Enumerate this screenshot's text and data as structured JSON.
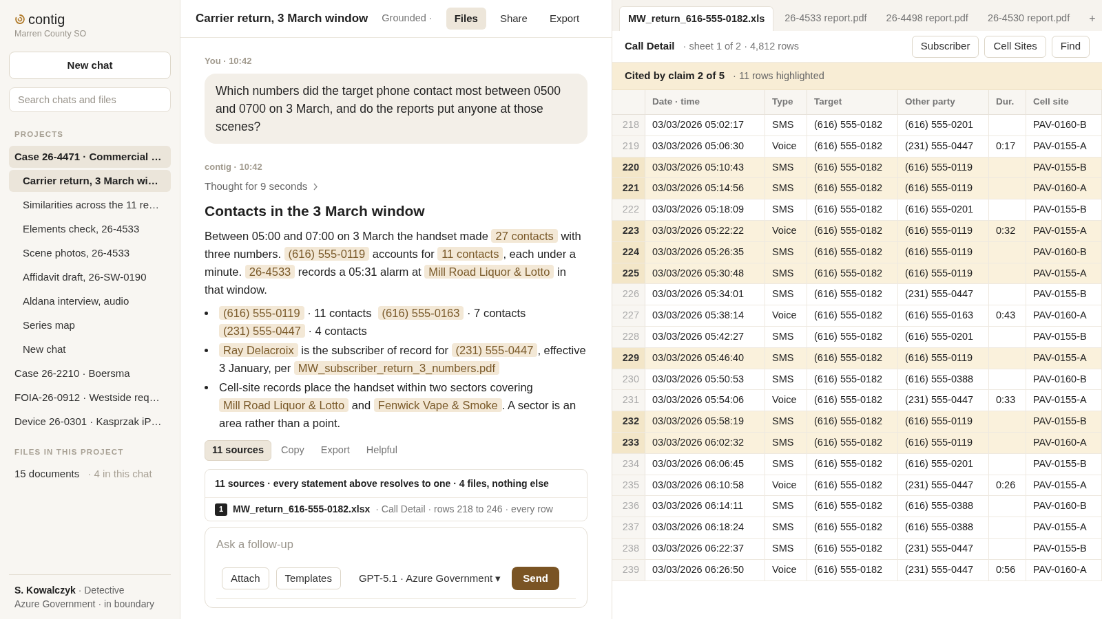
{
  "sidebar": {
    "brand": "contig",
    "org": "Marren County SO",
    "new_chat": "New chat",
    "search": {
      "placeholder": "Search chats and files"
    },
    "projects_heading": "PROJECTS",
    "projects": [
      {
        "label": "Case 26-4471 · Commercial …",
        "selected": true,
        "children": [
          {
            "label": "Carrier return, 3 March wi…",
            "selected": true
          },
          {
            "label": "Similarities across the 11 re…",
            "selected": false
          },
          {
            "label": "Elements check, 26-4533",
            "selected": false
          },
          {
            "label": "Scene photos, 26-4533",
            "selected": false
          },
          {
            "label": "Affidavit draft, 26-SW-0190",
            "selected": false
          },
          {
            "label": "Aldana interview, audio",
            "selected": false
          },
          {
            "label": "Series map",
            "selected": false
          },
          {
            "label": "New chat",
            "selected": false
          }
        ]
      },
      {
        "label": "Case 26-2210 · Boersma",
        "selected": false
      },
      {
        "label": "FOIA-26-0912 · Westside req…",
        "selected": false
      },
      {
        "label": "Device 26-0301 · Kasprzak iP…",
        "selected": false
      }
    ],
    "files_heading": "FILES IN THIS PROJECT",
    "files_count": "15 documents",
    "files_note": "· 4 in this chat",
    "user": {
      "name": "S. Kowalczyk",
      "role": "· Detective",
      "env": "Azure Government · in boundary"
    }
  },
  "chat": {
    "title": "Carrier return, 3 March window",
    "grounded": "Grounded ·",
    "header_tabs": [
      {
        "label": "Files",
        "selected": true
      },
      {
        "label": "Share",
        "selected": false
      },
      {
        "label": "Export",
        "selected": false
      }
    ],
    "user_meta": "You · 10:42",
    "user_message": "Which numbers did the target phone contact most between 0500 and 0700 on 3 March, and do the reports put anyone at those scenes?",
    "bot_meta": "contig · 10:42",
    "thought": "Thought for 9 seconds",
    "heading": "Contacts in the 3 March window",
    "paragraph": [
      {
        "text": "Between 05:00 and 07:00 on 3 March the handset made ",
        "cited": false
      },
      {
        "text": "27 contacts",
        "cited": true
      },
      {
        "text": " with three numbers. ",
        "cited": false
      },
      {
        "text": "(616) 555-0119",
        "cited": true
      },
      {
        "text": " accounts for ",
        "cited": false
      },
      {
        "text": "11 contacts",
        "cited": true
      },
      {
        "text": ", each under a minute. ",
        "cited": false
      },
      {
        "text": "26-4533",
        "cited": true
      },
      {
        "text": " records a 05:31 alarm at ",
        "cited": false
      },
      {
        "text": "Mill Road Liquor & Lotto",
        "cited": true
      },
      {
        "text": " in that window.",
        "cited": false
      }
    ],
    "bullets": [
      [
        {
          "text": "(616) 555-0119",
          "cited": true
        },
        {
          "text": " · 11 contacts  ",
          "cited": false
        },
        {
          "text": "(616) 555-0163",
          "cited": true
        },
        {
          "text": " · 7 contacts ",
          "cited": false
        },
        {
          "text": "(231) 555-0447",
          "cited": true
        },
        {
          "text": " · 4 contacts",
          "cited": false
        }
      ],
      [
        {
          "text": "Ray Delacroix",
          "cited": true
        },
        {
          "text": " is the subscriber of record for ",
          "cited": false
        },
        {
          "text": "(231) 555-0447",
          "cited": true
        },
        {
          "text": ", effective 3 January, per ",
          "cited": false
        },
        {
          "text": "MW_subscriber_return_3_numbers.pdf",
          "cited": true
        }
      ],
      [
        {
          "text": "Cell-site records place the handset within two sectors covering ",
          "cited": false
        },
        {
          "text": "Mill Road Liquor & Lotto",
          "cited": true
        },
        {
          "text": " and ",
          "cited": false
        },
        {
          "text": "Fenwick Vape & Smoke",
          "cited": true
        },
        {
          "text": ". A sector is an area rather than a point.",
          "cited": false
        }
      ]
    ],
    "actions": [
      {
        "label": "11 sources",
        "selected": true
      },
      {
        "label": "Copy",
        "selected": false
      },
      {
        "label": "Export",
        "selected": false
      },
      {
        "label": "Helpful",
        "selected": false
      }
    ],
    "sources_summary": "11 sources · every statement above resolves to one · 4 files, nothing else",
    "sources": [
      {
        "num": "1",
        "file": "MW_return_616-555-0182.xlsx",
        "detail": "· Call Detail · rows 218 to 246 · every row"
      }
    ],
    "composer": {
      "placeholder": "Ask a follow-up",
      "attach": "Attach",
      "templates": "Templates",
      "model": "GPT-5.1 · Azure Government ▾",
      "send": "Send"
    }
  },
  "viewer": {
    "tabs": [
      {
        "label": "MW_return_616-555-0182.xls",
        "selected": true
      },
      {
        "label": "26-4533 report.pdf",
        "selected": false
      },
      {
        "label": "26-4498 report.pdf",
        "selected": false
      },
      {
        "label": "26-4530 report.pdf",
        "selected": false
      }
    ],
    "add_tab": "+",
    "sheet": "Call Detail",
    "sheet_info": "· sheet 1 of 2 · 4,812 rows",
    "buttons": [
      "Subscriber",
      "Cell Sites",
      "Find"
    ],
    "banner": {
      "title": "Cited by claim 2 of 5",
      "note": "· 11 rows highlighted"
    },
    "table": {
      "columns": [
        "Date · time",
        "Type",
        "Target",
        "Other party",
        "Dur.",
        "Cell site"
      ],
      "rows": [
        {
          "num": "218",
          "cells": [
            "03/03/2026 05:02:17",
            "SMS",
            "(616) 555-0182",
            "(616) 555-0201",
            "",
            "PAV-0160-B"
          ],
          "highlighted": false
        },
        {
          "num": "219",
          "cells": [
            "03/03/2026 05:06:30",
            "Voice",
            "(616) 555-0182",
            "(231) 555-0447",
            "0:17",
            "PAV-0155-A"
          ],
          "highlighted": false
        },
        {
          "num": "220",
          "cells": [
            "03/03/2026 05:10:43",
            "SMS",
            "(616) 555-0182",
            "(616) 555-0119",
            "",
            "PAV-0155-B"
          ],
          "highlighted": true
        },
        {
          "num": "221",
          "cells": [
            "03/03/2026 05:14:56",
            "SMS",
            "(616) 555-0182",
            "(616) 555-0119",
            "",
            "PAV-0160-A"
          ],
          "highlighted": true
        },
        {
          "num": "222",
          "cells": [
            "03/03/2026 05:18:09",
            "SMS",
            "(616) 555-0182",
            "(616) 555-0201",
            "",
            "PAV-0155-B"
          ],
          "highlighted": false
        },
        {
          "num": "223",
          "cells": [
            "03/03/2026 05:22:22",
            "Voice",
            "(616) 555-0182",
            "(616) 555-0119",
            "0:32",
            "PAV-0155-A"
          ],
          "highlighted": true
        },
        {
          "num": "224",
          "cells": [
            "03/03/2026 05:26:35",
            "SMS",
            "(616) 555-0182",
            "(616) 555-0119",
            "",
            "PAV-0160-B"
          ],
          "highlighted": true
        },
        {
          "num": "225",
          "cells": [
            "03/03/2026 05:30:48",
            "SMS",
            "(616) 555-0182",
            "(616) 555-0119",
            "",
            "PAV-0155-A"
          ],
          "highlighted": true
        },
        {
          "num": "226",
          "cells": [
            "03/03/2026 05:34:01",
            "SMS",
            "(616) 555-0182",
            "(231) 555-0447",
            "",
            "PAV-0155-B"
          ],
          "highlighted": false
        },
        {
          "num": "227",
          "cells": [
            "03/03/2026 05:38:14",
            "Voice",
            "(616) 555-0182",
            "(616) 555-0163",
            "0:43",
            "PAV-0160-A"
          ],
          "highlighted": false
        },
        {
          "num": "228",
          "cells": [
            "03/03/2026 05:42:27",
            "SMS",
            "(616) 555-0182",
            "(616) 555-0201",
            "",
            "PAV-0155-B"
          ],
          "highlighted": false
        },
        {
          "num": "229",
          "cells": [
            "03/03/2026 05:46:40",
            "SMS",
            "(616) 555-0182",
            "(616) 555-0119",
            "",
            "PAV-0155-A"
          ],
          "highlighted": true
        },
        {
          "num": "230",
          "cells": [
            "03/03/2026 05:50:53",
            "SMS",
            "(616) 555-0182",
            "(616) 555-0388",
            "",
            "PAV-0160-B"
          ],
          "highlighted": false
        },
        {
          "num": "231",
          "cells": [
            "03/03/2026 05:54:06",
            "Voice",
            "(616) 555-0182",
            "(231) 555-0447",
            "0:33",
            "PAV-0155-A"
          ],
          "highlighted": false
        },
        {
          "num": "232",
          "cells": [
            "03/03/2026 05:58:19",
            "SMS",
            "(616) 555-0182",
            "(616) 555-0119",
            "",
            "PAV-0155-B"
          ],
          "highlighted": true
        },
        {
          "num": "233",
          "cells": [
            "03/03/2026 06:02:32",
            "SMS",
            "(616) 555-0182",
            "(616) 555-0119",
            "",
            "PAV-0160-A"
          ],
          "highlighted": true
        },
        {
          "num": "234",
          "cells": [
            "03/03/2026 06:06:45",
            "SMS",
            "(616) 555-0182",
            "(616) 555-0201",
            "",
            "PAV-0155-B"
          ],
          "highlighted": false
        },
        {
          "num": "235",
          "cells": [
            "03/03/2026 06:10:58",
            "Voice",
            "(616) 555-0182",
            "(231) 555-0447",
            "0:26",
            "PAV-0155-A"
          ],
          "highlighted": false
        },
        {
          "num": "236",
          "cells": [
            "03/03/2026 06:14:11",
            "SMS",
            "(616) 555-0182",
            "(616) 555-0388",
            "",
            "PAV-0160-B"
          ],
          "highlighted": false
        },
        {
          "num": "237",
          "cells": [
            "03/03/2026 06:18:24",
            "SMS",
            "(616) 555-0182",
            "(616) 555-0388",
            "",
            "PAV-0155-A"
          ],
          "highlighted": false
        },
        {
          "num": "238",
          "cells": [
            "03/03/2026 06:22:37",
            "SMS",
            "(616) 555-0182",
            "(231) 555-0447",
            "",
            "PAV-0155-B"
          ],
          "highlighted": false
        },
        {
          "num": "239",
          "cells": [
            "03/03/2026 06:26:50",
            "Voice",
            "(616) 555-0182",
            "(231) 555-0447",
            "0:56",
            "PAV-0160-A"
          ],
          "highlighted": false
        }
      ]
    }
  }
}
